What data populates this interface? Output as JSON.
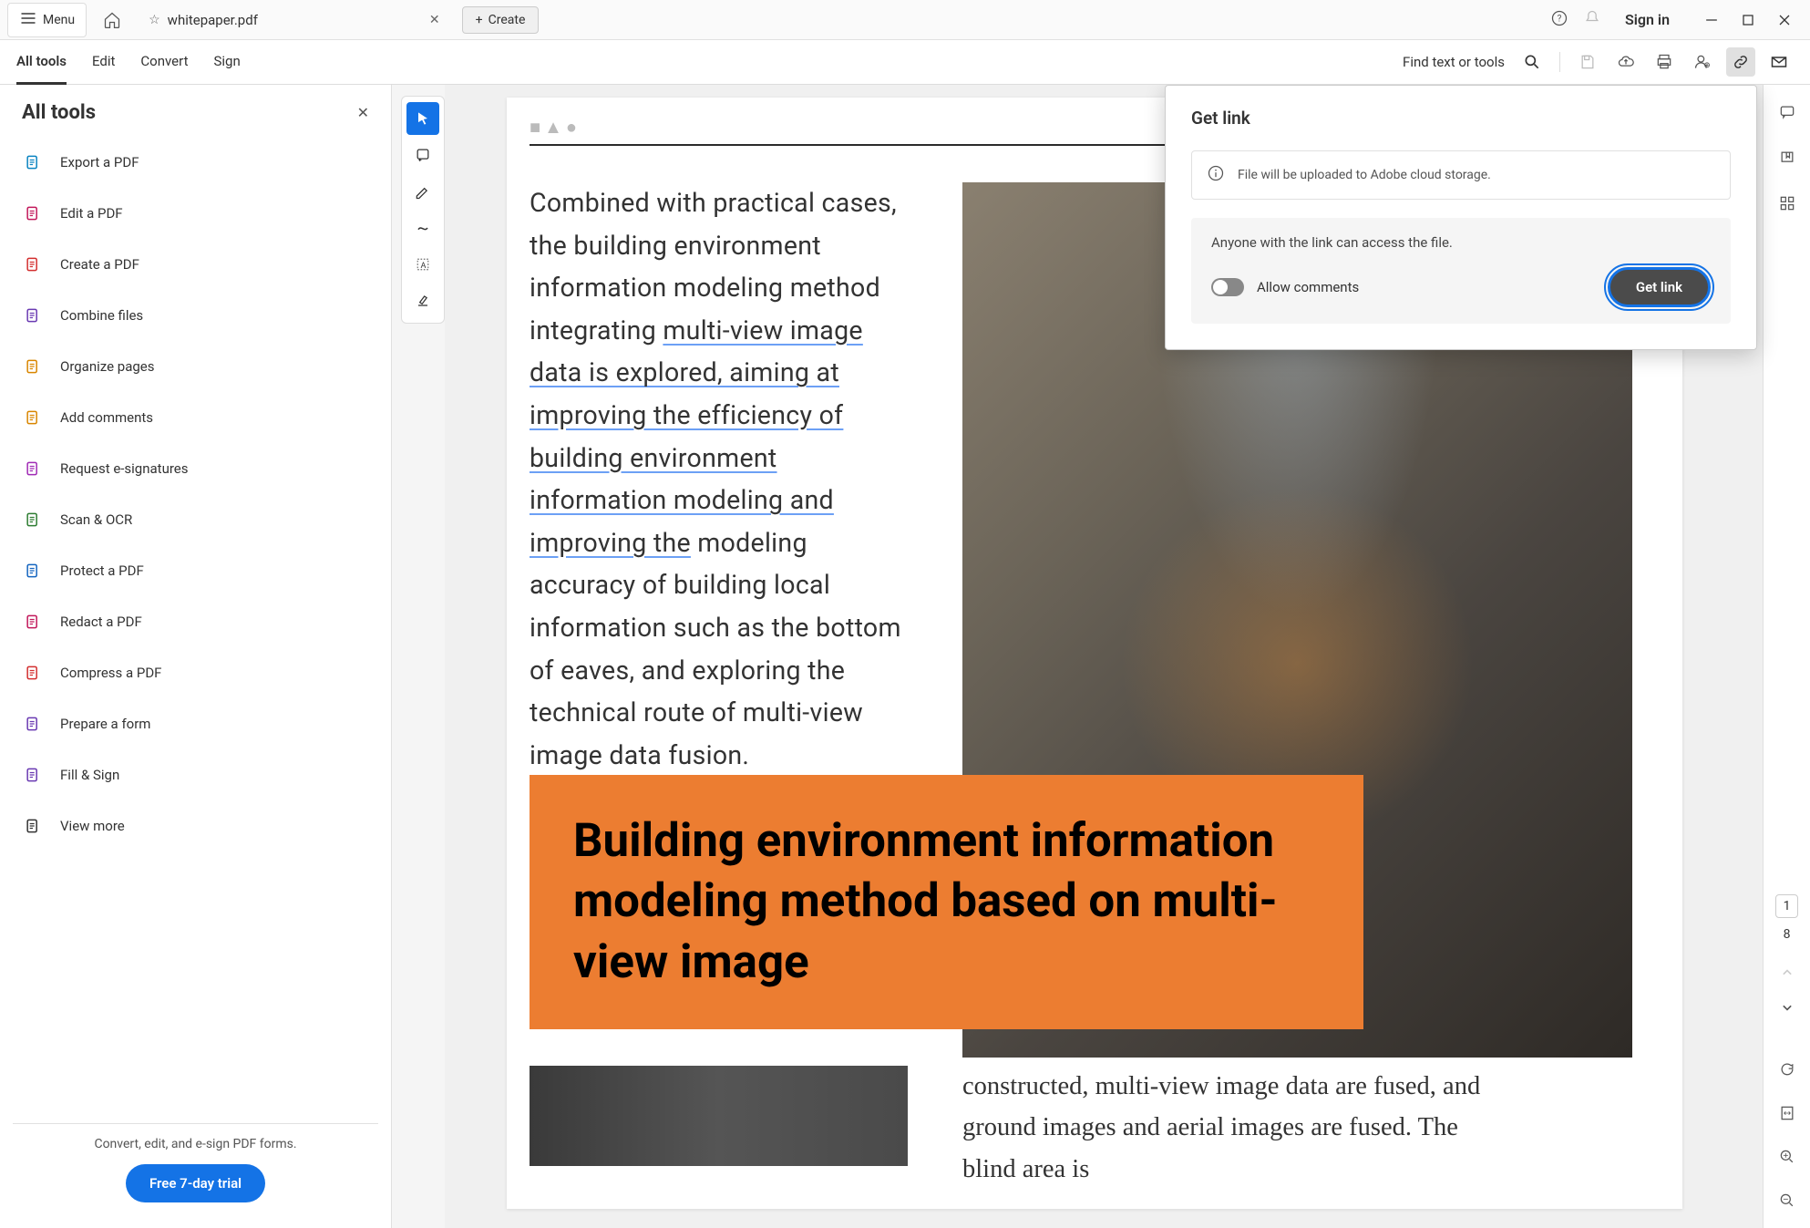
{
  "titlebar": {
    "menu_label": "Menu",
    "filename": "whitepaper.pdf",
    "create_label": "Create",
    "signin_label": "Sign in"
  },
  "toolbar": {
    "tabs": [
      "All tools",
      "Edit",
      "Convert",
      "Sign"
    ],
    "search_label": "Find text or tools"
  },
  "sidebar": {
    "title": "All tools",
    "items": [
      {
        "label": "Export a PDF",
        "icon": "export-icon",
        "color": "#0a84c1"
      },
      {
        "label": "Edit a PDF",
        "icon": "edit-icon",
        "color": "#c2185b"
      },
      {
        "label": "Create a PDF",
        "icon": "create-pdf-icon",
        "color": "#d32f2f"
      },
      {
        "label": "Combine files",
        "icon": "combine-icon",
        "color": "#6a3ab2"
      },
      {
        "label": "Organize pages",
        "icon": "organize-icon",
        "color": "#d98600"
      },
      {
        "label": "Add comments",
        "icon": "comment-icon",
        "color": "#d98600"
      },
      {
        "label": "Request e-signatures",
        "icon": "signature-icon",
        "color": "#a02bb5"
      },
      {
        "label": "Scan & OCR",
        "icon": "scan-icon",
        "color": "#2e7d32"
      },
      {
        "label": "Protect a PDF",
        "icon": "protect-icon",
        "color": "#1565c0"
      },
      {
        "label": "Redact a PDF",
        "icon": "redact-icon",
        "color": "#c2185b"
      },
      {
        "label": "Compress a PDF",
        "icon": "compress-icon",
        "color": "#d32f2f"
      },
      {
        "label": "Prepare a form",
        "icon": "form-icon",
        "color": "#6a3ab2"
      },
      {
        "label": "Fill & Sign",
        "icon": "fill-sign-icon",
        "color": "#6a3ab2"
      },
      {
        "label": "View more",
        "icon": "view-more-icon",
        "color": "#333"
      }
    ],
    "footer_text": "Convert, edit, and e-sign PDF forms.",
    "trial_label": "Free 7-day trial"
  },
  "document": {
    "body_text_pre": "Combined with practical cases, the building environment information modeling method integrating ",
    "body_text_under": "multi-view image data is explored, aiming at improving the efficiency of building environment information modeling and improving the",
    "body_text_post": " modeling accuracy of building local information such as the bottom of eaves, and exploring the technical route of multi-view image data fusion.",
    "banner_title": "Building environment information modeling method based on multi-view image",
    "below_text": "constructed, multi-view image data are fused, and ground images and aerial images are fused. The blind area is"
  },
  "popup": {
    "title": "Get link",
    "info_text": "File will be uploaded to Adobe cloud storage.",
    "access_text": "Anyone with the link can access the file.",
    "allow_comments_label": "Allow comments",
    "getlink_label": "Get link"
  },
  "nav": {
    "current_page": "1",
    "total_pages": "8"
  }
}
